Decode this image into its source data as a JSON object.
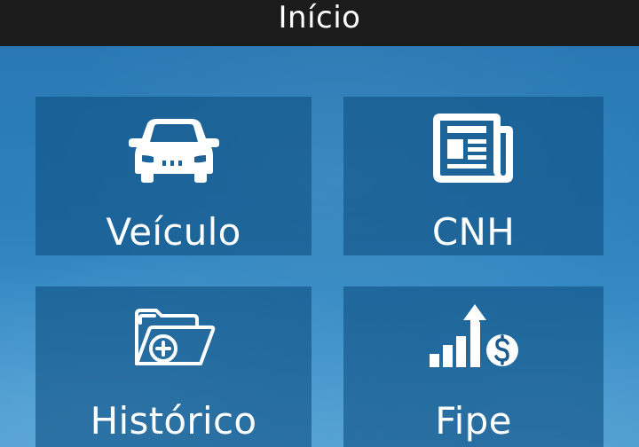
{
  "header": {
    "title": "Início"
  },
  "menu": {
    "items": [
      {
        "label": "Veículo",
        "icon": "car-icon"
      },
      {
        "label": "CNH",
        "icon": "newspaper-icon"
      },
      {
        "label": "Histórico",
        "icon": "folder-add-icon"
      },
      {
        "label": "Fipe",
        "icon": "price-chart-icon"
      }
    ]
  },
  "colors": {
    "topbar": "#1c1c1c",
    "background": "#2b80bc",
    "tile": "#1a5a8c",
    "foreground": "#ffffff"
  }
}
